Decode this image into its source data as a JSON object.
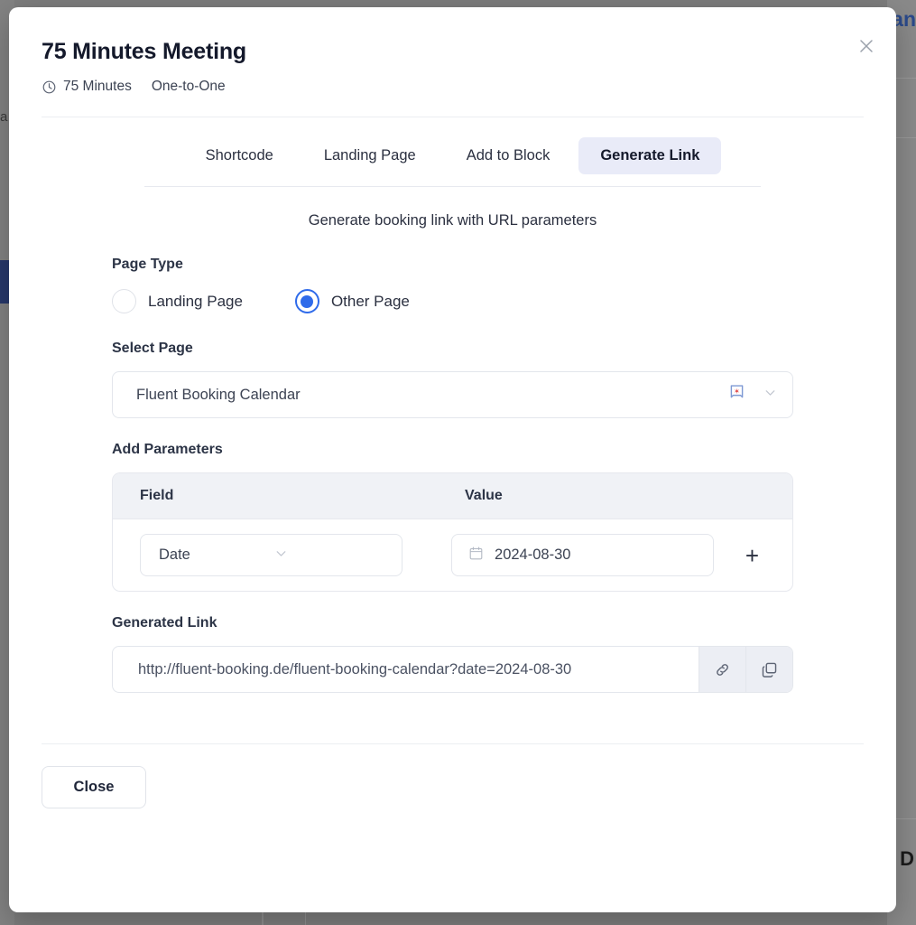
{
  "background": {
    "right_title_fragment": "lan",
    "left_letter_fragment": "a",
    "bottom_right_letter_fragment": "D"
  },
  "modal": {
    "title": "75 Minutes Meeting",
    "close_label": "×",
    "meta": [
      {
        "icon": "clock-icon",
        "label": "75 Minutes"
      },
      {
        "icon": "",
        "label": "One-to-One"
      }
    ],
    "tabs": [
      {
        "label": "Shortcode",
        "active": false
      },
      {
        "label": "Landing Page",
        "active": false
      },
      {
        "label": "Add to Block",
        "active": false
      },
      {
        "label": "Generate Link",
        "active": true
      }
    ],
    "intro": "Generate booking link with URL parameters",
    "page_type": {
      "label": "Page Type",
      "options": [
        {
          "label": "Landing Page",
          "selected": false
        },
        {
          "label": "Other Page",
          "selected": true
        }
      ]
    },
    "select_page": {
      "label": "Select Page",
      "value": "Fluent Booking Calendar",
      "badge_icon": "bookmark-star-icon",
      "chevron_icon": "chevron-down-icon"
    },
    "parameters": {
      "label": "Add Parameters",
      "columns": [
        "Field",
        "Value"
      ],
      "rows": [
        {
          "field": "Date",
          "value": "2024-08-30",
          "value_icon": "calendar-icon"
        }
      ],
      "add_label": "+"
    },
    "generated_link": {
      "label": "Generated Link",
      "value": "http://fluent-booking.de/fluent-booking-calendar?date=2024-08-30",
      "link_button_icon": "chain-link-icon",
      "copy_button_icon": "copy-icon"
    },
    "footer": {
      "close_label": "Close"
    },
    "colors": {
      "accent_blue": "#2f6bea",
      "active_tab_bg": "#e9ebf8",
      "table_header_bg": "#f0f2f6",
      "text_dark": "#14192b"
    }
  }
}
